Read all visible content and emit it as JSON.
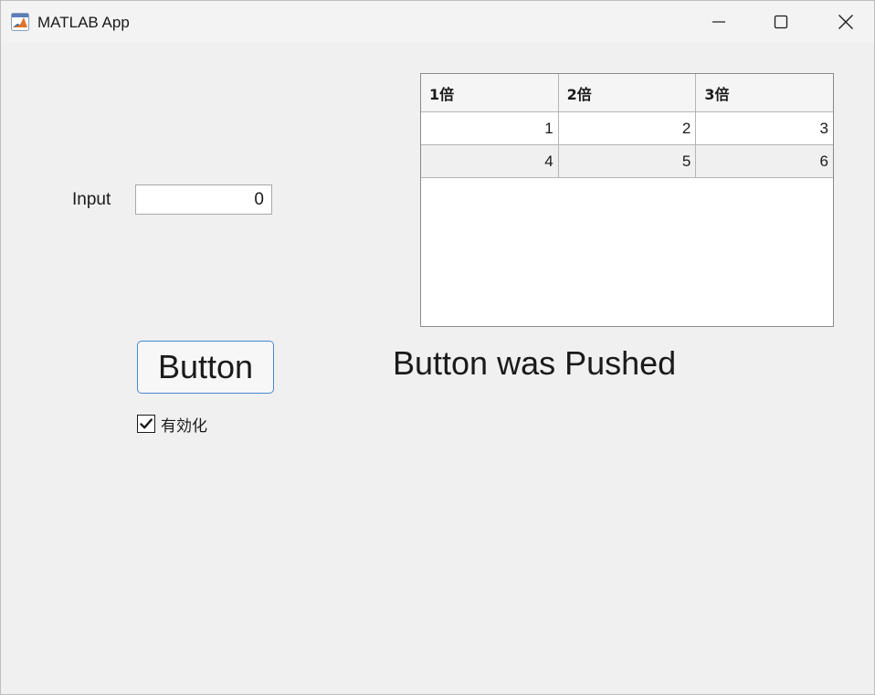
{
  "window": {
    "title": "MATLAB App",
    "icon": "matlab-logo-icon"
  },
  "form": {
    "input_label": "Input",
    "input_value": "0",
    "button_label": "Button",
    "checkbox_label": "有効化",
    "checkbox_checked": true,
    "status_text": "Button was Pushed"
  },
  "table": {
    "columns": [
      "1倍",
      "2倍",
      "3倍"
    ],
    "rows": [
      [
        "1",
        "2",
        "3"
      ],
      [
        "4",
        "5",
        "6"
      ]
    ]
  },
  "colors": {
    "background": "#f0f0f0",
    "button_border": "#4a86d4"
  }
}
